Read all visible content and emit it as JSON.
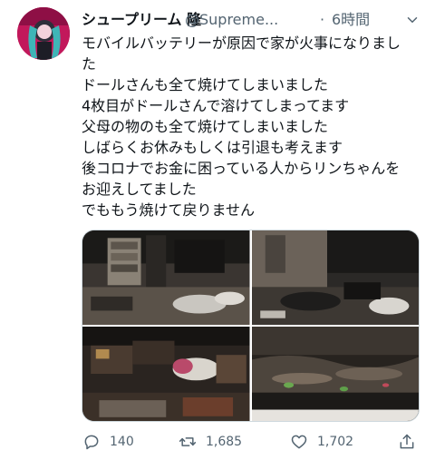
{
  "author": {
    "display_name": "シュープリーム 隆",
    "handle": "@Supreme...",
    "separator": "·",
    "time": "6時間"
  },
  "body_lines": [
    "モバイルバッテリーが原因で家が火事になりまし",
    "た",
    "ドールさんも全て焼けてしまいました",
    "4枚目がドールさんで溶けてしまってます",
    "父母の物のも全て焼けてしまいました",
    "しばらくお休みもしくは引退も考えます",
    "後コロナでお金に困っている人からリンちゃんを",
    "お迎えしてました",
    "でももう焼けて戻りません"
  ],
  "media": {
    "count": 4,
    "icons": [
      "burned-room-photo",
      "burned-room-photo",
      "burned-room-photo",
      "melted-doll-photo"
    ]
  },
  "actions": {
    "replies": "140",
    "retweets": "1,685",
    "likes": "1,702",
    "icons": {
      "reply": "reply-icon",
      "retweet": "retweet-icon",
      "like": "heart-icon",
      "share": "share-icon",
      "more": "more-icon"
    }
  },
  "colors": {
    "text": "#0f1419",
    "muted": "#536471",
    "border": "#cfd9de"
  }
}
